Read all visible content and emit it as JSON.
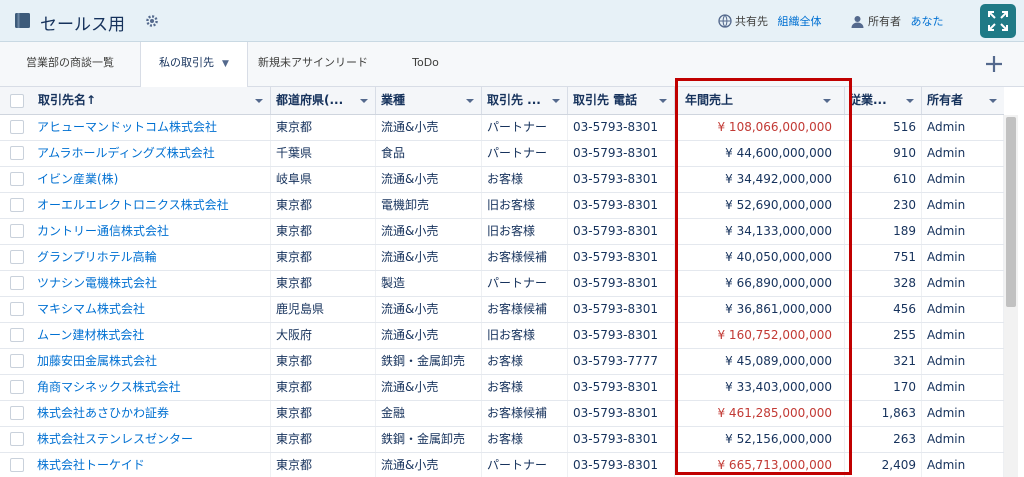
{
  "header": {
    "title": "セールス用",
    "share_label": "共有先",
    "share_value": "組織全体",
    "owner_label": "所有者",
    "owner_value": "あなた"
  },
  "tabs": [
    {
      "label": "営業部の商談一覧"
    },
    {
      "label": "私の取引先"
    },
    {
      "label": "新規未アサインリード"
    },
    {
      "label": "ToDo"
    }
  ],
  "columns": [
    {
      "label": "取引先名↑"
    },
    {
      "label": "都道府県(..."
    },
    {
      "label": "業種"
    },
    {
      "label": "取引先 ..."
    },
    {
      "label": "取引先 電話"
    },
    {
      "label": "年間売上"
    },
    {
      "label": "従業..."
    },
    {
      "label": "所有者"
    }
  ],
  "rows": [
    {
      "name": "アヒューマンドットコム株式会社",
      "pref": "東京都",
      "industry": "流通&小売",
      "type": "パートナー",
      "phone": "03-5793-8301",
      "revenue": "¥ 108,066,000,000",
      "emp": "516",
      "owner": "Admin",
      "highlight": true
    },
    {
      "name": "アムラホールディングズ株式会社",
      "pref": "千葉県",
      "industry": "食品",
      "type": "パートナー",
      "phone": "03-5793-8301",
      "revenue": "¥ 44,600,000,000",
      "emp": "910",
      "owner": "Admin",
      "highlight": false
    },
    {
      "name": "イビン産業(株)",
      "pref": "岐阜県",
      "industry": "流通&小売",
      "type": "お客様",
      "phone": "03-5793-8301",
      "revenue": "¥ 34,492,000,000",
      "emp": "610",
      "owner": "Admin",
      "highlight": false
    },
    {
      "name": "オーエルエレクトロニクス株式会社",
      "pref": "東京都",
      "industry": "電機卸売",
      "type": "旧お客様",
      "phone": "03-5793-8301",
      "revenue": "¥ 52,690,000,000",
      "emp": "230",
      "owner": "Admin",
      "highlight": false
    },
    {
      "name": "カントリー通信株式会社",
      "pref": "東京都",
      "industry": "流通&小売",
      "type": "旧お客様",
      "phone": "03-5793-8301",
      "revenue": "¥ 34,133,000,000",
      "emp": "189",
      "owner": "Admin",
      "highlight": false
    },
    {
      "name": "グランプリホテル高輪",
      "pref": "東京都",
      "industry": "流通&小売",
      "type": "お客様候補",
      "phone": "03-5793-8301",
      "revenue": "¥ 40,050,000,000",
      "emp": "751",
      "owner": "Admin",
      "highlight": false
    },
    {
      "name": "ツナシン電機株式会社",
      "pref": "東京都",
      "industry": "製造",
      "type": "パートナー",
      "phone": "03-5793-8301",
      "revenue": "¥ 66,890,000,000",
      "emp": "328",
      "owner": "Admin",
      "highlight": false
    },
    {
      "name": "マキシマム株式会社",
      "pref": "鹿児島県",
      "industry": "流通&小売",
      "type": "お客様候補",
      "phone": "03-5793-8301",
      "revenue": "¥ 36,861,000,000",
      "emp": "456",
      "owner": "Admin",
      "highlight": false
    },
    {
      "name": "ムーン建材株式会社",
      "pref": "大阪府",
      "industry": "流通&小売",
      "type": "旧お客様",
      "phone": "03-5793-8301",
      "revenue": "¥ 160,752,000,000",
      "emp": "255",
      "owner": "Admin",
      "highlight": true
    },
    {
      "name": "加藤安田金属株式会社",
      "pref": "東京都",
      "industry": "鉄鋼・金属卸売",
      "type": "お客様",
      "phone": "03-5793-7777",
      "revenue": "¥ 45,089,000,000",
      "emp": "321",
      "owner": "Admin",
      "highlight": false
    },
    {
      "name": "角商マシネックス株式会社",
      "pref": "東京都",
      "industry": "流通&小売",
      "type": "お客様",
      "phone": "03-5793-8301",
      "revenue": "¥ 33,403,000,000",
      "emp": "170",
      "owner": "Admin",
      "highlight": false
    },
    {
      "name": "株式会社あさひかわ証券",
      "pref": "東京都",
      "industry": "金融",
      "type": "お客様候補",
      "phone": "03-5793-8301",
      "revenue": "¥ 461,285,000,000",
      "emp": "1,863",
      "owner": "Admin",
      "highlight": true
    },
    {
      "name": "株式会社ステンレスゼンター",
      "pref": "東京都",
      "industry": "鉄鋼・金属卸売",
      "type": "お客様",
      "phone": "03-5793-8301",
      "revenue": "¥ 52,156,000,000",
      "emp": "263",
      "owner": "Admin",
      "highlight": false
    },
    {
      "name": "株式会社トーケイド",
      "pref": "東京都",
      "industry": "流通&小売",
      "type": "パートナー",
      "phone": "03-5793-8301",
      "revenue": "¥ 665,713,000,000",
      "emp": "2,409",
      "owner": "Admin",
      "highlight": true
    }
  ],
  "colors": {
    "link": "#0070d2",
    "highlight_revenue": "#c23934",
    "annotation_box": "#c00000",
    "header_bg": "#e7f1f7",
    "expand_button": "#1f7a86"
  },
  "icons": [
    "folder-icon",
    "gear-icon",
    "globe-icon",
    "user-icon",
    "expand-icon",
    "plus-icon",
    "sort-up-arrow",
    "chevron-down-icon"
  ]
}
